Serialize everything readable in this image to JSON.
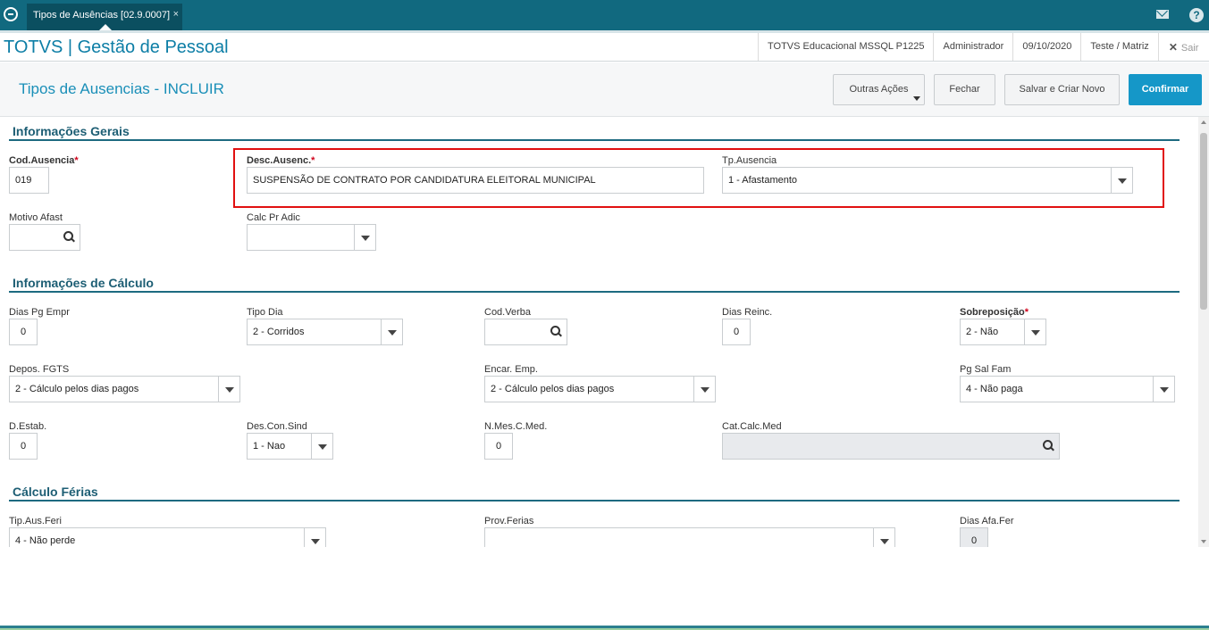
{
  "topbar": {
    "tab_label": "Tipos de Ausências [02.9.0007]",
    "tab_close": "×",
    "help_label": "?"
  },
  "app": {
    "title": "TOTVS | Gestão de Pessoal",
    "environment": "TOTVS Educacional MSSQL P1225",
    "user": "Administrador",
    "date": "09/10/2020",
    "branch": "Teste / Matriz",
    "exit_label": "Sair",
    "exit_icon_glyph": "✕"
  },
  "page": {
    "title": "Tipos de Ausencias - INCLUIR",
    "buttons": {
      "outras": "Outras Ações",
      "fechar": "Fechar",
      "salvar": "Salvar e Criar Novo",
      "confirmar": "Confirmar"
    }
  },
  "sections": {
    "gerais": "Informações Gerais",
    "calculo": "Informações de Cálculo",
    "ferias": "Cálculo Férias"
  },
  "fields": {
    "cod_ausencia": {
      "label": "Cod.Ausencia",
      "value": "019"
    },
    "desc_ausenc": {
      "label": "Desc.Ausenc.",
      "value": "SUSPENSÃO DE CONTRATO POR CANDIDATURA ELEITORAL MUNICIPAL"
    },
    "tp_ausencia": {
      "label": "Tp.Ausencia",
      "value": "1 - Afastamento"
    },
    "motivo_afast": {
      "label": "Motivo Afast",
      "value": ""
    },
    "calc_pr_adic": {
      "label": "Calc Pr Adic",
      "value": ""
    },
    "dias_pg_empr": {
      "label": "Dias Pg Empr",
      "value": "0"
    },
    "tipo_dia": {
      "label": "Tipo Dia",
      "value": "2 - Corridos"
    },
    "cod_verba": {
      "label": "Cod.Verba",
      "value": ""
    },
    "dias_reinc": {
      "label": "Dias Reinc.",
      "value": "0"
    },
    "sobreposicao": {
      "label": "Sobreposição",
      "value": "2 - Não"
    },
    "depos_fgts": {
      "label": "Depos. FGTS",
      "value": "2 - Cálculo pelos dias pagos"
    },
    "encar_emp": {
      "label": "Encar. Emp.",
      "value": "2 - Cálculo pelos dias pagos"
    },
    "pg_sal_fam": {
      "label": "Pg Sal Fam",
      "value": "4 - Não paga"
    },
    "d_estab": {
      "label": "D.Estab.",
      "value": "0"
    },
    "des_con_sind": {
      "label": "Des.Con.Sind",
      "value": "1 - Nao"
    },
    "n_mes_c_med": {
      "label": "N.Mes.C.Med.",
      "value": "0"
    },
    "cat_calc_med": {
      "label": "Cat.Calc.Med",
      "value": ""
    },
    "tip_aus_feri": {
      "label": "Tip.Aus.Feri",
      "value": "4 - Não perde"
    },
    "prov_ferias": {
      "label": "Prov.Ferias",
      "value": ""
    },
    "dias_afa_fer": {
      "label": "Dias Afa.Fer",
      "value": "0"
    }
  },
  "required_mark": "*",
  "colors": {
    "topbar": "#11697f",
    "accent": "#1597c8",
    "highlight": "#e11010",
    "section_title": "#1d5e74"
  }
}
